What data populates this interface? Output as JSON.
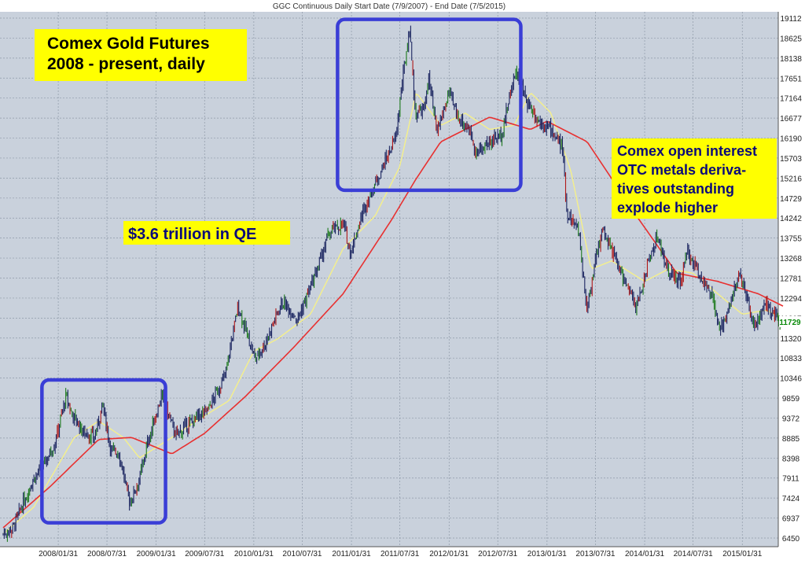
{
  "chart_data": {
    "type": "candlestick",
    "title": "GGC Continuous Daily  Start Date (7/9/2007) - End Date (7/5/2015)",
    "x_tick_labels": [
      "2008/01/31",
      "2008/07/31",
      "2009/01/31",
      "2009/07/31",
      "2010/01/31",
      "2010/07/31",
      "2011/01/31",
      "2011/07/31",
      "2012/01/31",
      "2012/07/31",
      "2013/01/31",
      "2013/07/31",
      "2014/01/31",
      "2014/07/31",
      "2015/01/31"
    ],
    "y_tick_labels": [
      "19112",
      "18625",
      "18138",
      "17651",
      "17164",
      "16677",
      "16190",
      "15703",
      "15216",
      "14729",
      "14242",
      "13755",
      "13268",
      "12781",
      "12294",
      "11807",
      "11320",
      "10833",
      "10346",
      "9859",
      "9372",
      "8885",
      "8398",
      "7911",
      "7424",
      "6937",
      "6450"
    ],
    "ylim": [
      6450,
      19112
    ],
    "last_value": 11729,
    "grid": true,
    "colors": {
      "plot_bg": "#c9d1dc",
      "grid": "#8e99a8",
      "bar_up": "#1d7a1d",
      "bar_down": "#b01818",
      "bar_neutral": "#1b2560",
      "ma_short": "#f5f08a",
      "ma_long": "#e83030",
      "box_stroke": "#3a3ed6",
      "note_bg": "#ffff00"
    },
    "series": [
      {
        "type": "price",
        "x": [
          "2007/07/09",
          "2007/08/15",
          "2007/09/15",
          "2007/10/31",
          "2007/11/30",
          "2008/01/15",
          "2008/02/29",
          "2008/03/17",
          "2008/04/30",
          "2008/06/15",
          "2008/07/15",
          "2008/08/15",
          "2008/09/15",
          "2008/10/24",
          "2008/11/30",
          "2008/12/31",
          "2009/02/20",
          "2009/04/15",
          "2009/06/15",
          "2009/08/15",
          "2009/10/15",
          "2009/12/03",
          "2010/02/05",
          "2010/03/15",
          "2010/05/15",
          "2010/07/15",
          "2010/09/15",
          "2010/11/10",
          "2010/12/31",
          "2011/01/28",
          "2011/03/15",
          "2011/05/15",
          "2011/07/15",
          "2011/08/10",
          "2011/09/06",
          "2011/09/26",
          "2011/10/31",
          "2011/11/15",
          "2011/12/15",
          "2012/01/31",
          "2012/02/29",
          "2012/04/15",
          "2012/05/15",
          "2012/06/30",
          "2012/08/15",
          "2012/10/05",
          "2012/11/15",
          "2012/12/31",
          "2013/02/15",
          "2013/03/31",
          "2013/04/15",
          "2013/05/31",
          "2013/06/28",
          "2013/07/31",
          "2013/08/27",
          "2013/10/15",
          "2013/12/31",
          "2014/02/15",
          "2014/03/17",
          "2014/04/30",
          "2014/06/15",
          "2014/07/10",
          "2014/08/31",
          "2014/10/15",
          "2014/11/07",
          "2015/01/22",
          "2015/02/15",
          "2015/03/17",
          "2015/04/30",
          "2015/06/15",
          "2015/07/02"
        ],
        "values": [
          6550,
          6700,
          7200,
          7900,
          8150,
          8700,
          9900,
          9550,
          9050,
          8900,
          9700,
          8600,
          8500,
          7300,
          7900,
          8800,
          9900,
          8950,
          9300,
          9600,
          10400,
          12100,
          10800,
          11200,
          12200,
          11800,
          12800,
          13900,
          14100,
          13400,
          14400,
          15300,
          16200,
          17600,
          18900,
          16800,
          16900,
          17700,
          16300,
          17300,
          16750,
          16400,
          15800,
          16100,
          16300,
          17850,
          17100,
          16600,
          16400,
          15900,
          14400,
          13900,
          12000,
          13200,
          14000,
          13200,
          12050,
          13200,
          13800,
          12900,
          12700,
          13400,
          12800,
          12200,
          11450,
          12900,
          12300,
          11600,
          12100,
          11800,
          11729
        ]
      },
      {
        "name": "",
        "type": "moving_average_short",
        "x": [
          "2007/07/09",
          "2007/10/31",
          "2008/03/31",
          "2008/06/30",
          "2008/09/30",
          "2008/11/30",
          "2009/03/31",
          "2009/06/30",
          "2009/10/31",
          "2010/01/31",
          "2010/04/30",
          "2010/08/31",
          "2010/12/31",
          "2011/04/30",
          "2011/07/31",
          "2011/09/30",
          "2011/12/31",
          "2012/03/31",
          "2012/06/30",
          "2012/09/30",
          "2012/11/30",
          "2013/02/15",
          "2013/04/30",
          "2013/07/15",
          "2013/09/30",
          "2014/01/31",
          "2014/04/30",
          "2014/07/31",
          "2014/10/31",
          "2015/01/31",
          "2015/04/30",
          "2015/07/02"
        ],
        "values": [
          6550,
          7200,
          8900,
          9300,
          8900,
          8400,
          8900,
          9300,
          9800,
          11000,
          11300,
          11900,
          13500,
          14300,
          15500,
          17300,
          16500,
          16800,
          16400,
          16500,
          17300,
          16800,
          15400,
          13000,
          13200,
          12700,
          13000,
          12900,
          12400,
          11900,
          12000,
          11800
        ]
      },
      {
        "name": "",
        "type": "moving_average_long",
        "x": [
          "2007/07/09",
          "2007/12/31",
          "2008/06/30",
          "2008/10/31",
          "2009/03/31",
          "2009/07/31",
          "2009/12/31",
          "2010/06/30",
          "2010/12/31",
          "2011/06/30",
          "2011/09/30",
          "2011/12/31",
          "2012/06/30",
          "2012/11/30",
          "2013/01/31",
          "2013/06/30",
          "2013/12/31",
          "2014/05/31",
          "2014/10/31",
          "2015/03/31",
          "2015/07/02"
        ],
        "values": [
          6700,
          7700,
          8850,
          8900,
          8500,
          9000,
          9900,
          11100,
          12400,
          14200,
          15200,
          16100,
          16700,
          16400,
          16600,
          16100,
          14300,
          12900,
          12700,
          12400,
          12100
        ]
      }
    ]
  },
  "annotations": {
    "title_box": {
      "line1": "Comex Gold Futures",
      "line2": "2008 - present, daily"
    },
    "qe_box": {
      "line1": "$3.6 trillion in QE"
    },
    "oi_box": {
      "line1": "Comex open interest",
      "line2": "OTC metals deriva-",
      "line3": "tives outstanding",
      "line4": "explode higher"
    }
  }
}
